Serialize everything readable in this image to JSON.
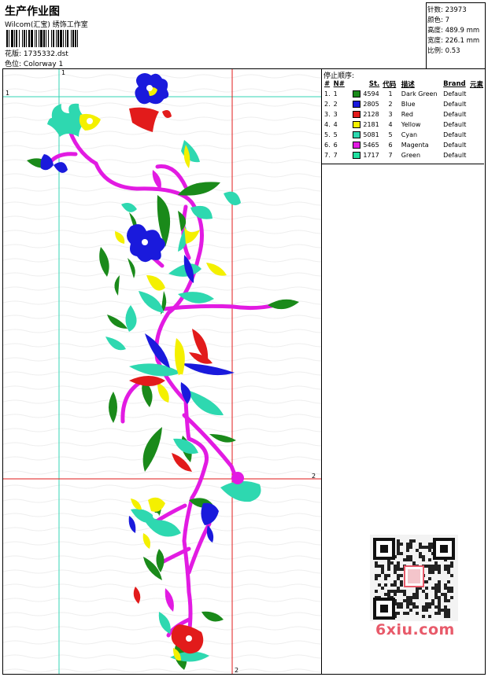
{
  "header": {
    "title": "生产作业图",
    "studio": "Wilcom(汇宝) 绣饰工作室",
    "design_label": "花版:",
    "design_file": "1735332.dst",
    "colorway_label": "色位:",
    "colorway": "Colorway 1"
  },
  "stats": {
    "stitches_label": "针数:",
    "stitches": "23973",
    "colors_label": "颜色:",
    "colors": "7",
    "height_label": "高度:",
    "height": "489.9 mm",
    "width_label": "宽度:",
    "width": "226.1 mm",
    "scale_label": "比例:",
    "scale": "0.53"
  },
  "stop_sequence": {
    "title": "停止顺序:",
    "columns": [
      "#",
      "N#",
      "St.",
      "代码",
      "描述",
      "Brand",
      "元素"
    ],
    "rows": [
      {
        "idx": "1.",
        "n": "1",
        "st": "4594",
        "code": "1",
        "desc": "Dark Green",
        "brand": "Default",
        "color": "#1a8a1a"
      },
      {
        "idx": "2.",
        "n": "2",
        "st": "2805",
        "code": "2",
        "desc": "Blue",
        "brand": "Default",
        "color": "#1a1adc"
      },
      {
        "idx": "3.",
        "n": "3",
        "st": "2128",
        "code": "3",
        "desc": "Red",
        "brand": "Default",
        "color": "#e21b1b"
      },
      {
        "idx": "4.",
        "n": "4",
        "st": "2181",
        "code": "4",
        "desc": "Yellow",
        "brand": "Default",
        "color": "#f4f000"
      },
      {
        "idx": "5.",
        "n": "5",
        "st": "5081",
        "code": "5",
        "desc": "Cyan",
        "brand": "Default",
        "color": "#2ed8b0"
      },
      {
        "idx": "6.",
        "n": "6",
        "st": "5465",
        "code": "6",
        "desc": "Magenta",
        "brand": "Default",
        "color": "#e21be2"
      },
      {
        "idx": "7.",
        "n": "7",
        "st": "1717",
        "code": "7",
        "desc": "Green",
        "brand": "Default",
        "color": "#22e0a0"
      }
    ]
  },
  "guides": {
    "label_1": "1",
    "label_2": "2"
  },
  "watermark": {
    "text": "6xiu.com",
    "stamp": "汇宝刺绣"
  },
  "palette": {
    "dark_green": "#1a8a1a",
    "blue": "#1a1adc",
    "red": "#e21b1b",
    "yellow": "#f4f000",
    "cyan": "#2ed8b0",
    "magenta": "#e21be2",
    "green": "#22e0a0",
    "guide_cyan": "#33d6b4",
    "guide_red": "#e21b1b"
  }
}
